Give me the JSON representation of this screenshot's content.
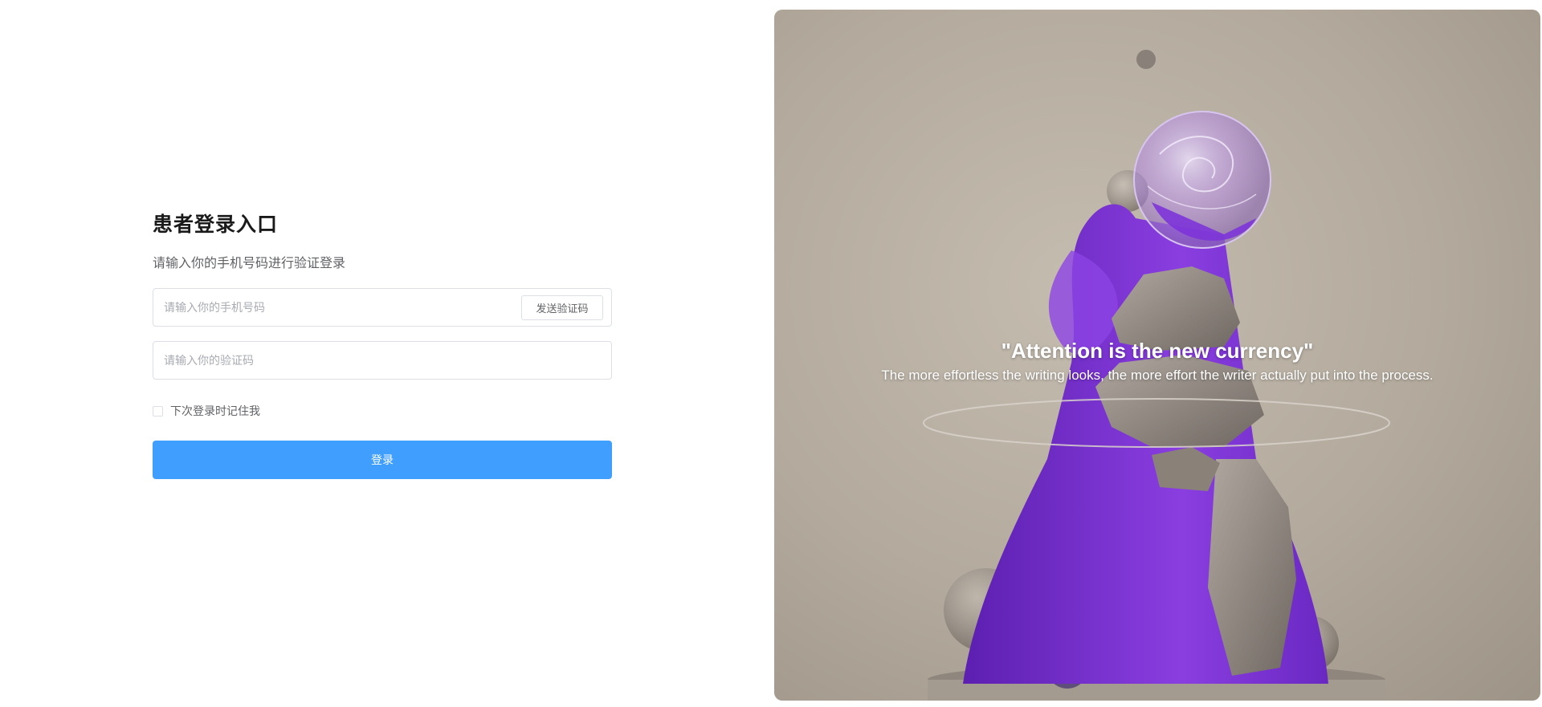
{
  "login": {
    "title": "患者登录入口",
    "subtitle": "请输入你的手机号码进行验证登录",
    "phone_placeholder": "请输入你的手机号码",
    "send_code_label": "发送验证码",
    "code_placeholder": "请输入你的验证码",
    "remember_label": "下次登录时记住我",
    "submit_label": "登录",
    "remember_checked": false
  },
  "hero": {
    "quote_title": "\"Attention is the new currency\"",
    "quote_text": "The more effortless the writing looks, the more effort the writer actually put into the process."
  },
  "colors": {
    "primary": "#409eff",
    "fur": "#7b35d6",
    "stone": "#9a918a",
    "background": "#b8afa3"
  }
}
